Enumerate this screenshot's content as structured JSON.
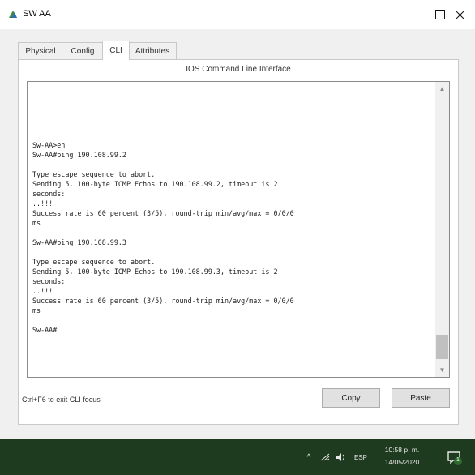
{
  "window": {
    "title": "SW AA"
  },
  "tabs": [
    {
      "label": "Physical"
    },
    {
      "label": "Config"
    },
    {
      "label": "CLI"
    },
    {
      "label": "Attributes"
    }
  ],
  "panel": {
    "title": "IOS Command Line Interface"
  },
  "terminal": {
    "output": "\n\n\n\n\n\nSw-AA>en\nSw-AA#ping 190.108.99.2\n\nType escape sequence to abort.\nSending 5, 100-byte ICMP Echos to 190.108.99.2, timeout is 2\nseconds:\n..!!!\nSuccess rate is 60 percent (3/5), round-trip min/avg/max = 0/0/0\nms\n\nSw-AA#ping 190.108.99.3\n\nType escape sequence to abort.\nSending 5, 100-byte ICMP Echos to 190.108.99.3, timeout is 2\nseconds:\n..!!!\nSuccess rate is 60 percent (3/5), round-trip min/avg/max = 0/0/0\nms\n\nSw-AA#"
  },
  "footer": {
    "hint": "Ctrl+F6 to exit CLI focus",
    "copy_label": "Copy",
    "paste_label": "Paste"
  },
  "taskbar": {
    "language": "ESP",
    "time": "10:58 p. m.",
    "date": "14/05/2020",
    "notification_count": "1"
  },
  "colors": {
    "taskbar_bg": "#1f3b1f",
    "content_bg": "#f0f0f0"
  },
  "icons": [
    "app-icon",
    "minimize-icon",
    "maximize-icon",
    "close-icon",
    "chevron-up-icon",
    "network-icon",
    "volume-icon",
    "notification-icon"
  ]
}
